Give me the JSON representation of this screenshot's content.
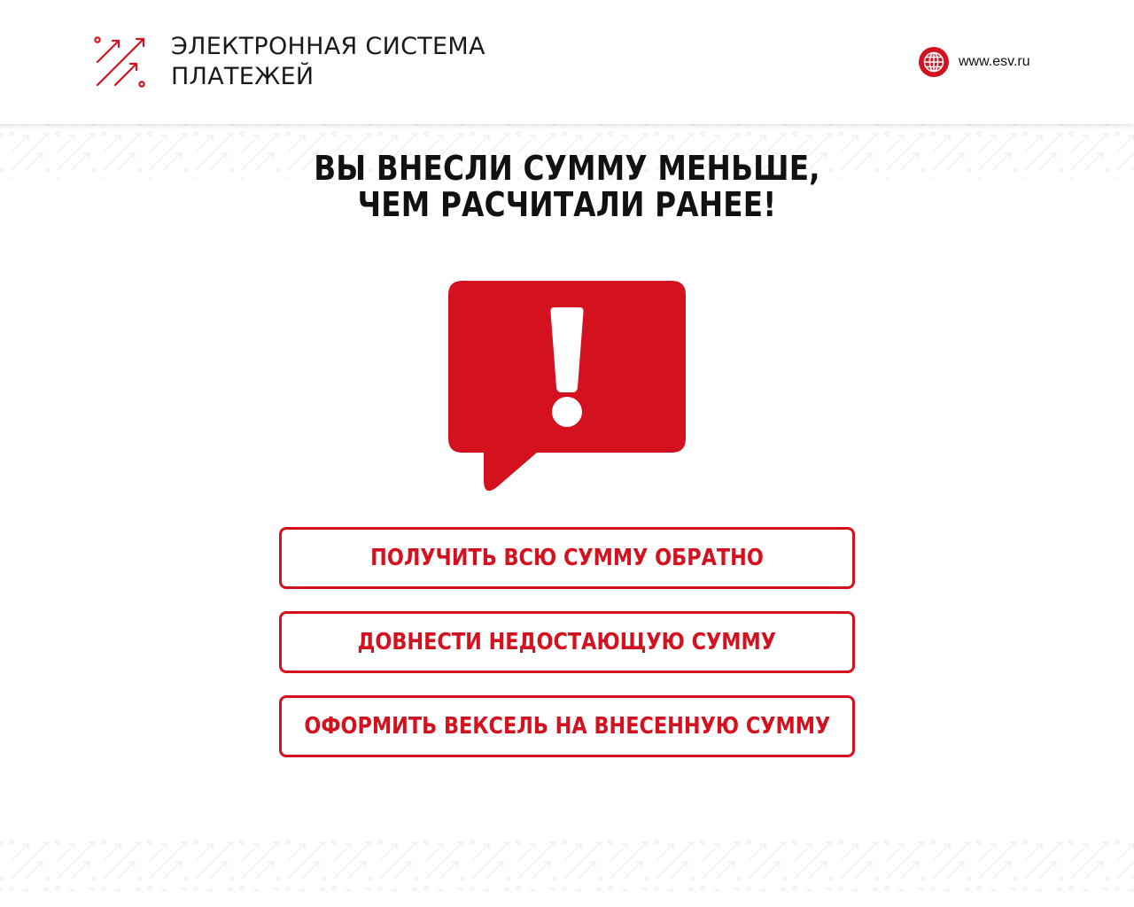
{
  "header": {
    "logo_line1": "ЭЛЕКТРОННАЯ СИСТЕМА",
    "logo_line2": "ПЛАТЕЖЕЙ",
    "site_url": "www.esv.ru"
  },
  "main": {
    "title_line1": "ВЫ ВНЕСЛИ СУММУ МЕНЬШЕ,",
    "title_line2": "ЧЕМ РАСЧИТАЛИ РАНЕЕ!",
    "alert_icon": "exclamation-speech-bubble-icon",
    "buttons": [
      {
        "label": "ПОЛУЧИТЬ ВСЮ СУММУ ОБРАТНО"
      },
      {
        "label": "ДОВНЕСТИ НЕДОСТАЮЩУЮ СУММУ"
      },
      {
        "label": "ОФОРМИТЬ ВЕКСЕЛЬ НА ВНЕСЕННУЮ СУММУ"
      }
    ]
  },
  "colors": {
    "accent": "#d4111e",
    "text": "#111111",
    "background": "#ffffff",
    "pattern": "#e3e3e3"
  }
}
